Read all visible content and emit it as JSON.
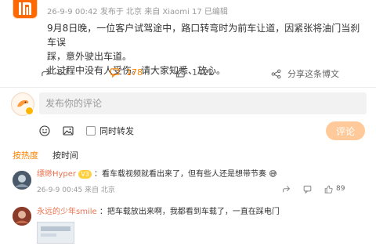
{
  "post": {
    "meta": "26-9-9 00:42 发布于 北京 来自 Xiaomi 17 已编辑",
    "text_line1": "9月8日晚，一位客户试驾途中，路口转弯时为前车让道，因紧张将油门当刹车误",
    "text_line2": "踩，意外驶出车道。",
    "text_line3": "此过程中没有人受伤。请大家知悉、放心。"
  },
  "actions": {
    "share_count": "80",
    "comment_count": "178",
    "like_count": "1422",
    "share_long_image": "分享这条博文"
  },
  "composer": {
    "placeholder": "发布你的评论",
    "repost_label": "同时转发",
    "submit_label": "评论"
  },
  "sort": {
    "hot": "按热度",
    "time": "按时间"
  },
  "comments": [
    {
      "name": "缥缈Hyper",
      "text": "：看车载视频就看出来了，但有些人还是想带节奏",
      "meta": "26-9-9 00:45 来自 北京",
      "like_count": "89"
    },
    {
      "name": "永远的少年smile",
      "text": "：把车载放出来啊，我都看到车载了，一直在踩电门"
    }
  ],
  "colors": {
    "accent": "#ff8200",
    "username": "#eb7350",
    "submit_disabled": "#ffc999",
    "brand_logo_bg": "#ff6900"
  }
}
